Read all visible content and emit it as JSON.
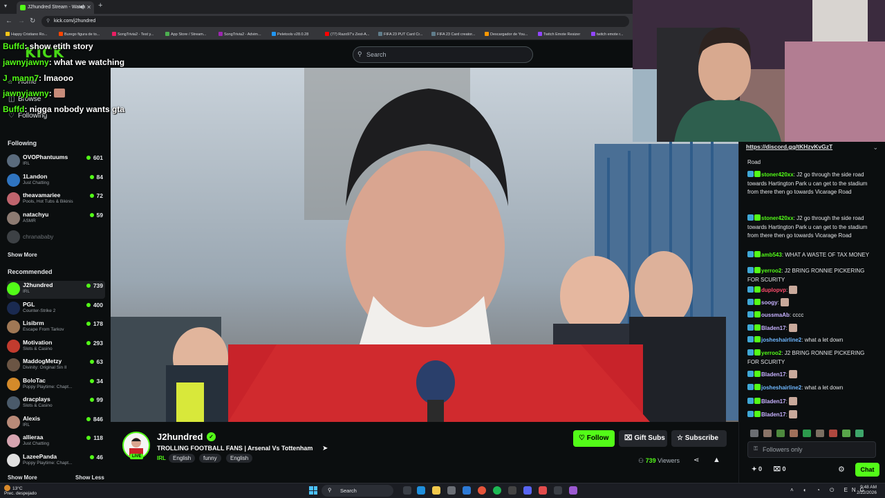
{
  "browser": {
    "tab_title": "J2hundred Stream - Watch",
    "url": "kick.com/j2hundred",
    "bookmarks": [
      {
        "label": "Happy Cristiano Ro...",
        "color": "#f5c518"
      },
      {
        "label": "Burego figura de to...",
        "color": "#ff4500"
      },
      {
        "label": "SongTrivia2 - Test y...",
        "color": "#e91e63"
      },
      {
        "label": "App Store / Stream...",
        "color": "#4caf50"
      },
      {
        "label": "SongTrivia2 - Advim...",
        "color": "#9c27b0"
      },
      {
        "label": "Peletools v28.0.28",
        "color": "#2196f3"
      },
      {
        "label": "(77) Razo97's Zest-A...",
        "color": "#ff0000"
      },
      {
        "label": "FIFA 23 PUT Card Cr...",
        "color": "#607d8b"
      },
      {
        "label": "FIFA 23 Card creator...",
        "color": "#607d8b"
      },
      {
        "label": "Descargador de You...",
        "color": "#ff9800"
      },
      {
        "label": "Twitch Emote Resizer",
        "color": "#9146ff"
      },
      {
        "label": "twitch emote r...",
        "color": "#9146ff"
      }
    ]
  },
  "header": {
    "logo": "KICK",
    "search_placeholder": "Search"
  },
  "overlay_chat": [
    {
      "user": "Buffd",
      "msg": ": show etith story"
    },
    {
      "user": "jawnyjawny",
      "msg": ": what we watching"
    },
    {
      "user": "J_mann7",
      "msg": ": lmaooo"
    },
    {
      "user": "jawnyjawny",
      "msg": ":"
    },
    {
      "user": "Buffd",
      "msg": ": nigga nobody wants gta"
    }
  ],
  "sidebar": {
    "nav": {
      "home": "Home",
      "browse": "Browse",
      "following": "Following"
    },
    "following_heading": "Following",
    "following": [
      {
        "name": "OVOPhantuums",
        "category": "IRL",
        "viewers": "601",
        "color": "#5a6b7d"
      },
      {
        "name": "1Landon",
        "category": "Just Chatting",
        "viewers": "84",
        "color": "#2f74c0"
      },
      {
        "name": "theavamariee",
        "category": "Pools, Hot Tubs & Bikinis",
        "viewers": "72",
        "color": "#c0646d"
      },
      {
        "name": "natachyu",
        "category": "ASMR",
        "viewers": "59",
        "color": "#8d7b72"
      }
    ],
    "offline": {
      "name": "chranababy",
      "color": "#8a8f96"
    },
    "show_more": "Show More",
    "recommended_heading": "Recommended",
    "recommended": [
      {
        "name": "J2hundred",
        "category": "IRL",
        "viewers": "739",
        "color": "#53fc18"
      },
      {
        "name": "PGL",
        "category": "Counter-Strike 2",
        "viewers": "400",
        "color": "#1a2a50"
      },
      {
        "name": "Lisibrm",
        "category": "Escape From Tarkov",
        "viewers": "178",
        "color": "#a07855"
      },
      {
        "name": "Motivation",
        "category": "Slots & Casino",
        "viewers": "293",
        "color": "#c23b2e"
      },
      {
        "name": "MaddogMetzy",
        "category": "Divinity: Original Sin II",
        "viewers": "63",
        "color": "#6b5544"
      },
      {
        "name": "BoloTac",
        "category": "Poppy Playtime: Chapt...",
        "viewers": "34",
        "color": "#d48a2a"
      },
      {
        "name": "dracplays",
        "category": "Slots & Casino",
        "viewers": "99",
        "color": "#4a5a6a"
      },
      {
        "name": "Alexis",
        "category": "IRL",
        "viewers": "846",
        "color": "#b98a78"
      },
      {
        "name": "allieraa",
        "category": "Just Chatting",
        "viewers": "118",
        "color": "#d6a4b0"
      },
      {
        "name": "LazeePanda",
        "category": "Poppy Playtime: Chapt...",
        "viewers": "46",
        "color": "#e0e0e0"
      }
    ],
    "show_more_2": "Show More",
    "show_less": "Show Less"
  },
  "stream": {
    "channel_name": "J2hundred",
    "live_label": "LIVE",
    "title": "TROLLING FOOTBALL FANS | Arsenal Vs Tottenham",
    "category": "IRL",
    "tags": [
      "English",
      "funny",
      "English"
    ],
    "follow_label": "Follow",
    "gift_subs_label": "Gift Subs",
    "subscribe_label": "Subscribe",
    "viewers_count": "739",
    "viewers_label": "Viewers"
  },
  "chat": {
    "pinned_link": "https://discord.gg/tKHzvKvGzT",
    "messages": [
      {
        "user": "",
        "text": "Road",
        "color": "#e3e5e8"
      },
      {
        "user": "stoner420xx",
        "text": ": J2 go through the side road towards Hartington Park u can get to the stadium from there then go towards Vicarage Road",
        "color": "#53fc18"
      },
      {
        "user": "stoner420xx",
        "text": ": J2 go through the side road towards Hartington Park u can get to the stadium from there then go towards Vicarage Road",
        "color": "#53fc18"
      },
      {
        "user": "amb543",
        "text": ": WHAT A WASTE OF TAX MONEY",
        "color": "#53fc18"
      },
      {
        "user": "yerroo2",
        "text": ": J2 BRING RONNIE PICKERING FOR SCURITY",
        "color": "#53fc18"
      },
      {
        "user": "duplopvp",
        "text": ":",
        "color": "#ff4d6d"
      },
      {
        "user": "soogy",
        "text": ":",
        "color": "#c7b2ff"
      },
      {
        "user": "oussmaAb",
        "text": ": cccc",
        "color": "#c7b2ff"
      },
      {
        "user": "Bladen17",
        "text": ":",
        "color": "#c7b2ff"
      },
      {
        "user": "josheshairline2",
        "text": ": what a let down",
        "color": "#6fb7ff"
      },
      {
        "user": "yerroo2",
        "text": ": J2 BRING RONNIE PICKERING FOR SCURITY",
        "color": "#53fc18"
      },
      {
        "user": "Bladen17",
        "text": ":",
        "color": "#c7b2ff"
      },
      {
        "user": "josheshairline2",
        "text": ": what a let down",
        "color": "#6fb7ff"
      },
      {
        "user": "Bladen17",
        "text": ":",
        "color": "#c7b2ff"
      },
      {
        "user": "Bladen17",
        "text": ":",
        "color": "#c7b2ff"
      }
    ],
    "input_placeholder": "Followers only",
    "kick_count": "0",
    "gift_count": "0",
    "chat_button": "Chat"
  },
  "taskbar": {
    "temp": "13°C",
    "weather": "Prec. despejado",
    "search": "Search",
    "lang": "ENG",
    "time": "9:48 AM",
    "date": "2/22/2026"
  }
}
